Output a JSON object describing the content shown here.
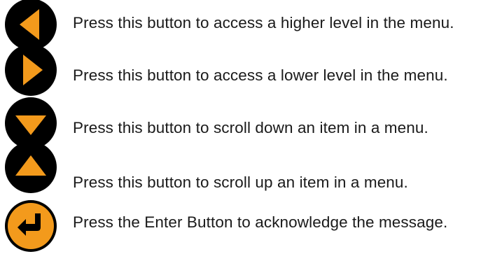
{
  "colors": {
    "button_fill": "#000000",
    "arrow_fill": "#f39a1c",
    "enter_ring": "#f39a1c",
    "enter_arrow": "#000000"
  },
  "items": [
    {
      "icon": "left-arrow-icon",
      "text": "Press this button to access a higher level in the menu."
    },
    {
      "icon": "right-arrow-icon",
      "text": "Press this button to access a lower level in the menu."
    },
    {
      "icon": "down-arrow-icon",
      "text": "Press this button to scroll down an item in a menu."
    },
    {
      "icon": "up-arrow-icon",
      "text": "Press this button to scroll up an item in a menu."
    },
    {
      "icon": "enter-icon",
      "text": "Press the Enter Button to acknowledge the message."
    }
  ]
}
